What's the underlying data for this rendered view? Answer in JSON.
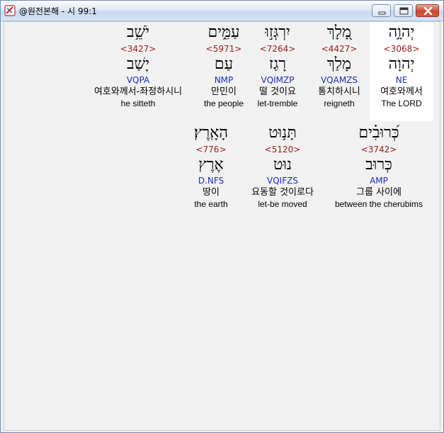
{
  "window": {
    "title": "@원전본해 - 시 99:1",
    "icon": "scroll-icon",
    "controls": [
      "minimize-icon",
      "maximize-icon",
      "close-icon"
    ]
  },
  "words": [
    {
      "hebrew": "יְהוָ֣ה",
      "strong": "<3068>",
      "root": "יְהוָה",
      "parse": "NE",
      "korean": "여호와께서",
      "english": "The LORD"
    },
    {
      "hebrew": "מָ֭לָךְ",
      "strong": "<4427>",
      "root": "מָלַךְ",
      "parse": "VQAMZS",
      "korean": "통치하시니",
      "english": "reigneth"
    },
    {
      "hebrew": "יִרְגְּז֣וּ",
      "strong": "<7264>",
      "root": "רָגַז",
      "parse": "VQIMZP",
      "korean": "떨 것이요",
      "english": "let-tremble"
    },
    {
      "hebrew": "עַמִּ֑ים",
      "strong": "<5971>",
      "root": "עַם",
      "parse": "NMP",
      "korean": "만민이",
      "english": "the people"
    },
    {
      "hebrew": "יֹשֵׁ֥ב",
      "strong": "<3427>",
      "root": "יָשַׁב",
      "parse": "VQPA",
      "korean": "여호와께서-좌정하시니",
      "english": "he sitteth"
    },
    {
      "hebrew": "כְּ֝רוּבִ֗ים",
      "strong": "<3742>",
      "root": "כְּרוּב",
      "parse": "AMP",
      "korean": "그룹 사이에",
      "english": "between the cherubims"
    },
    {
      "hebrew": "תָּנ֥וּט",
      "strong": "<5120>",
      "root": "נוּט",
      "parse": "VQIFZS",
      "korean": "요동할 것이로다",
      "english": "let-be moved"
    },
    {
      "hebrew": "הָאָֽרֶץ׃",
      "strong": "<776>",
      "root": "אֶרֶץ",
      "parse": "D.NFS",
      "korean": "땅이",
      "english": "the earth"
    }
  ]
}
